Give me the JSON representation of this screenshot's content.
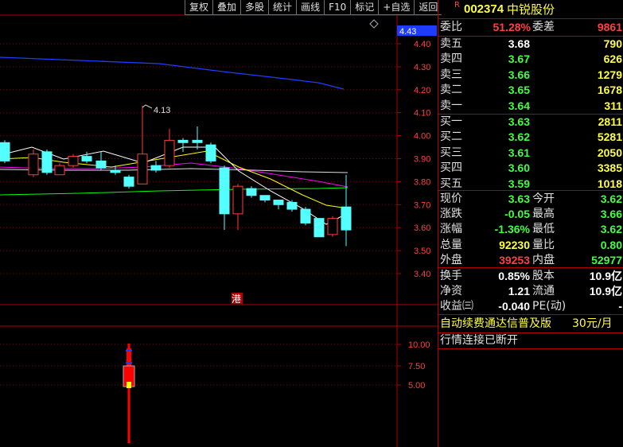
{
  "toolbar": [
    "复权",
    "叠加",
    "多股",
    "统计",
    "画线",
    "F10",
    "标记",
    "+自选",
    "返回"
  ],
  "chart": {
    "price_axis": [
      "4.40",
      "4.30",
      "4.20",
      "4.10",
      "4.00",
      "3.90",
      "3.80",
      "3.70",
      "3.60",
      "3.50",
      "3.40"
    ],
    "current_price_tag": "4.43",
    "high_annotation": "4.13",
    "sub_axis": [
      "10.00",
      "7.50",
      "5.00"
    ],
    "hk_marker": "港",
    "colors": {
      "up": "#ff3c3c",
      "down": "#54ffff",
      "ma1": "#ffffff",
      "ma2": "#ffff00",
      "ma3": "#ff00ff",
      "ma4": "#00ff00",
      "ma5": "#1e3cff",
      "grid": "#8b0000"
    }
  },
  "quote": {
    "code_prefix": "R",
    "code": "002374",
    "name": "中锐股份",
    "ratio_label": "委比",
    "ratio_value": "51.28%",
    "diff_label": "委差",
    "diff_value": "9861",
    "asks": [
      {
        "label": "卖五",
        "price": "3.68",
        "vol": "790"
      },
      {
        "label": "卖四",
        "price": "3.67",
        "vol": "626"
      },
      {
        "label": "卖三",
        "price": "3.66",
        "vol": "1279"
      },
      {
        "label": "卖二",
        "price": "3.65",
        "vol": "1678"
      },
      {
        "label": "卖一",
        "price": "3.64",
        "vol": "311"
      }
    ],
    "bids": [
      {
        "label": "买一",
        "price": "3.63",
        "vol": "2811"
      },
      {
        "label": "买二",
        "price": "3.62",
        "vol": "5281"
      },
      {
        "label": "买三",
        "price": "3.61",
        "vol": "2050"
      },
      {
        "label": "买四",
        "price": "3.60",
        "vol": "3385"
      },
      {
        "label": "买五",
        "price": "3.59",
        "vol": "1018"
      }
    ],
    "stats": [
      {
        "l1": "现价",
        "v1": "3.63",
        "c1": "green",
        "l2": "今开",
        "v2": "3.62",
        "c2": "green"
      },
      {
        "l1": "涨跌",
        "v1": "-0.05",
        "c1": "green",
        "l2": "最高",
        "v2": "3.66",
        "c2": "green"
      },
      {
        "l1": "涨幅",
        "v1": "-1.36%",
        "c1": "green",
        "l2": "最低",
        "v2": "3.62",
        "c2": "green"
      },
      {
        "l1": "总量",
        "v1": "92230",
        "c1": "yellow",
        "l2": "量比",
        "v2": "0.80",
        "c2": "green"
      },
      {
        "l1": "外盘",
        "v1": "39253",
        "c1": "red",
        "l2": "内盘",
        "v2": "52977",
        "c2": "green"
      }
    ],
    "fundamentals": [
      {
        "l1": "换手",
        "v1": "0.85%",
        "l2": "股本",
        "v2": "10.9亿"
      },
      {
        "l1": "净资",
        "v1": "1.21",
        "l2": "流通",
        "v2": "10.9亿"
      },
      {
        "l1": "收益㈢",
        "v1": "-0.040",
        "l2": "PE(动)",
        "v2": "-"
      }
    ],
    "promo": "自动续费通达信普及版",
    "promo_price": "30元/月",
    "status": "行情连接已断开"
  }
}
